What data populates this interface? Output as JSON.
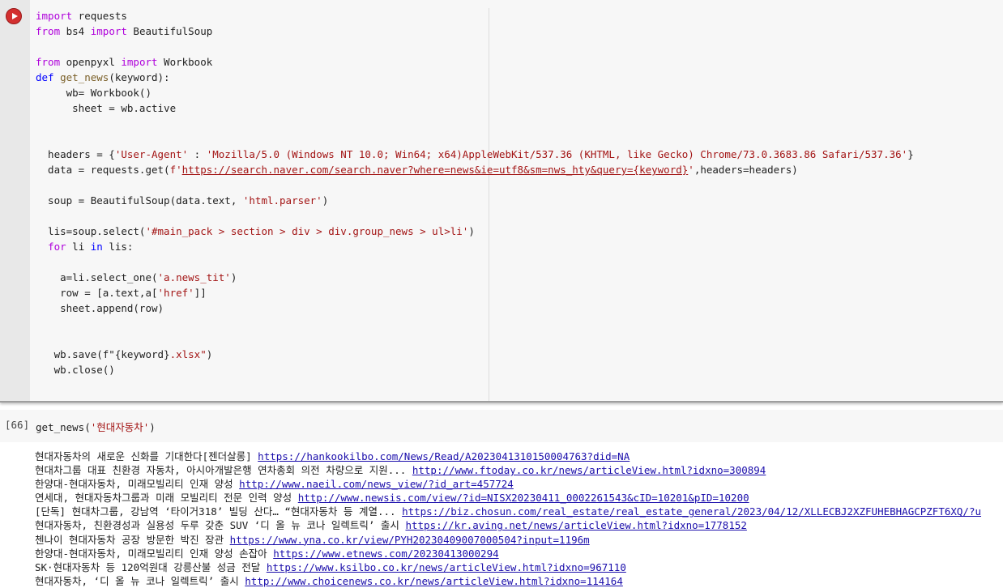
{
  "cell1": {
    "code": {
      "l1": [
        "import",
        " requests"
      ],
      "l2": [
        "from",
        " bs4 ",
        "import",
        " BeautifulSoup"
      ],
      "l4": [
        "from",
        " openpyxl ",
        "import",
        " Workbook"
      ],
      "l5": [
        "def",
        " ",
        "get_news",
        "(keyword):"
      ],
      "l6": "     wb= Workbook()",
      "l7": "      sheet = wb.active",
      "l10": [
        "  headers = {",
        "'User-Agent'",
        " : ",
        "'Mozilla/5.0 (Windows NT 10.0; Win64; x64)AppleWebKit/537.36 (KHTML, like Gecko) Chrome/73.0.3683.86 Safari/537.36'",
        "}"
      ],
      "l11": [
        "  data = requests.get(",
        "f'",
        "https://search.naver.com/search.naver?where=news&ie=utf8&sm=nws_hty&query=",
        "{keyword}",
        "'",
        ",headers=headers)"
      ],
      "l13": [
        "  soup = BeautifulSoup(data.text, ",
        "'html.parser'",
        ")"
      ],
      "l15": [
        "  lis=soup.select(",
        "'#main_pack > section > div > div.group_news > ul>li'",
        ")"
      ],
      "l16": [
        "  ",
        "for",
        " li ",
        "in",
        " lis:"
      ],
      "l18": [
        "    a=li.select_one(",
        "'a.news_tit'",
        ")"
      ],
      "l19": [
        "    row = [a.text,a[",
        "'href'",
        "]]"
      ],
      "l20": "    sheet.append(row)",
      "l23": [
        "   wb.save(f\"{keyword}",
        ".xlsx\"",
        ")"
      ],
      "l24": "   wb.close()"
    }
  },
  "cell2": {
    "exec_count": "[66]",
    "call": [
      "get_news(",
      "'현대자동차'",
      ")"
    ]
  },
  "output": [
    {
      "text": "현대자동차의 새로운 신화를 기대한다[젠더살롱]",
      "url": "https://hankookilbo.com/News/Read/A2023041310150004763?did=NA"
    },
    {
      "text": "현대차그룹 대표 친환경 자동차, 아시아개발은행 연차총회 의전 차량으로 지원...",
      "url": "http://www.ftoday.co.kr/news/articleView.html?idxno=300894"
    },
    {
      "text": "한양대-현대자동차, 미래모빌리티 인재 양성",
      "url": "http://www.naeil.com/news_view/?id_art=457724"
    },
    {
      "text": "연세대, 현대자동차그룹과 미래 모빌리티 전문 인력 양성",
      "url": "http://www.newsis.com/view/?id=NISX20230411_0002261543&cID=10201&pID=10200"
    },
    {
      "text": "[단독] 현대차그룹, 강남역 ‘타이거318’ 빌딩 산다… “현대자동차 등 계열...",
      "url": "https://biz.chosun.com/real_estate/real_estate_general/2023/04/12/XLLECBJ2XZFUHEBHAGCPZFT6XQ/?u"
    },
    {
      "text": "현대자동차, 친환경성과 실용성 두루 갖춘 SUV ‘디 올 뉴 코나 일렉트릭’ 출시",
      "url": "https://kr.aving.net/news/articleView.html?idxno=1778152"
    },
    {
      "text": "첸나이 현대자동차 공장 방문한 박진 장관",
      "url": "https://www.yna.co.kr/view/PYH20230409007000504?input=1196m"
    },
    {
      "text": "한양대-현대자동차, 미래모빌리티 인재 양성 손잡아",
      "url": "https://www.etnews.com/20230413000294"
    },
    {
      "text": "SK·현대자동차 등 120억원대 강릉산불 성금 전달",
      "url": "https://www.ksilbo.co.kr/news/articleView.html?idxno=967110"
    },
    {
      "text": "현대자동차, ‘디 올 뉴 코나 일렉트릭’ 출시",
      "url": "http://www.choicenews.co.kr/news/articleView.html?idxno=114164"
    }
  ]
}
